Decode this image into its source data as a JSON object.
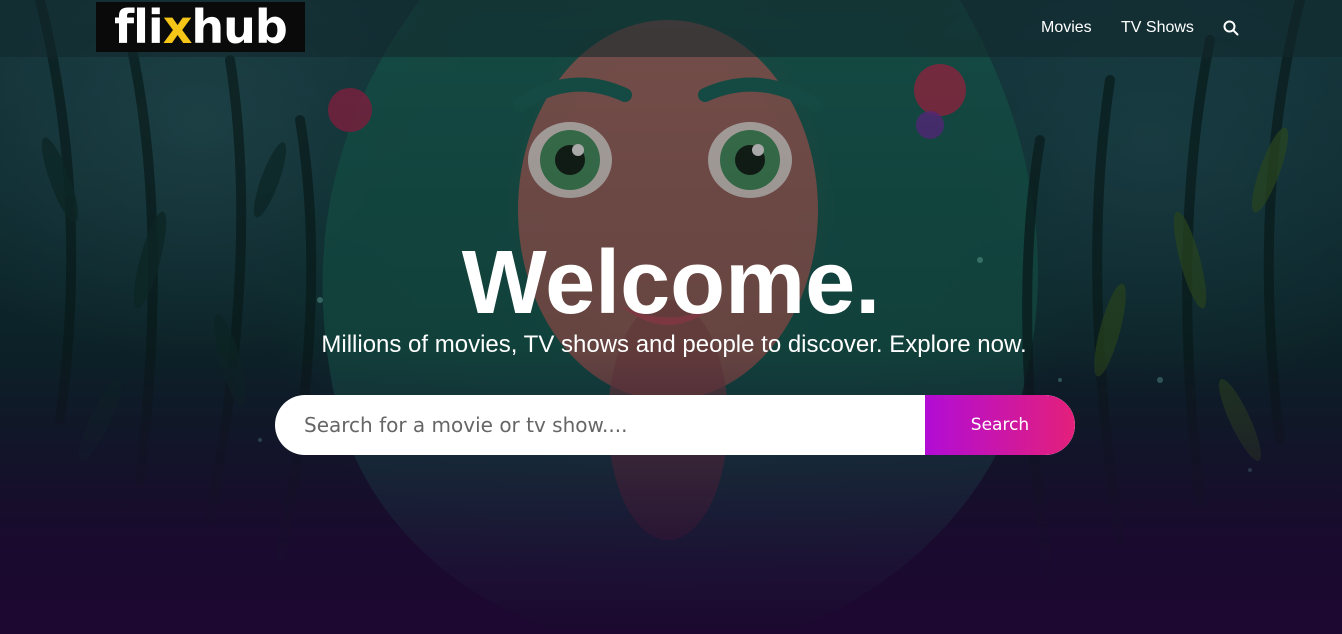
{
  "brand": {
    "logo_main": "fli",
    "logo_accent": "x",
    "logo_end": "hub"
  },
  "nav": {
    "movies": "Movies",
    "tv_shows": "TV Shows",
    "search_icon": "search-icon"
  },
  "hero": {
    "title": "Welcome.",
    "subtitle": "Millions of movies, TV shows and people to discover. Explore now."
  },
  "search": {
    "placeholder": "Search for a movie or tv show....",
    "value": "",
    "button_label": "Search"
  },
  "colors": {
    "accent_start": "#b10cd6",
    "accent_end": "#e4207a",
    "logo_accent": "#f5c518"
  }
}
